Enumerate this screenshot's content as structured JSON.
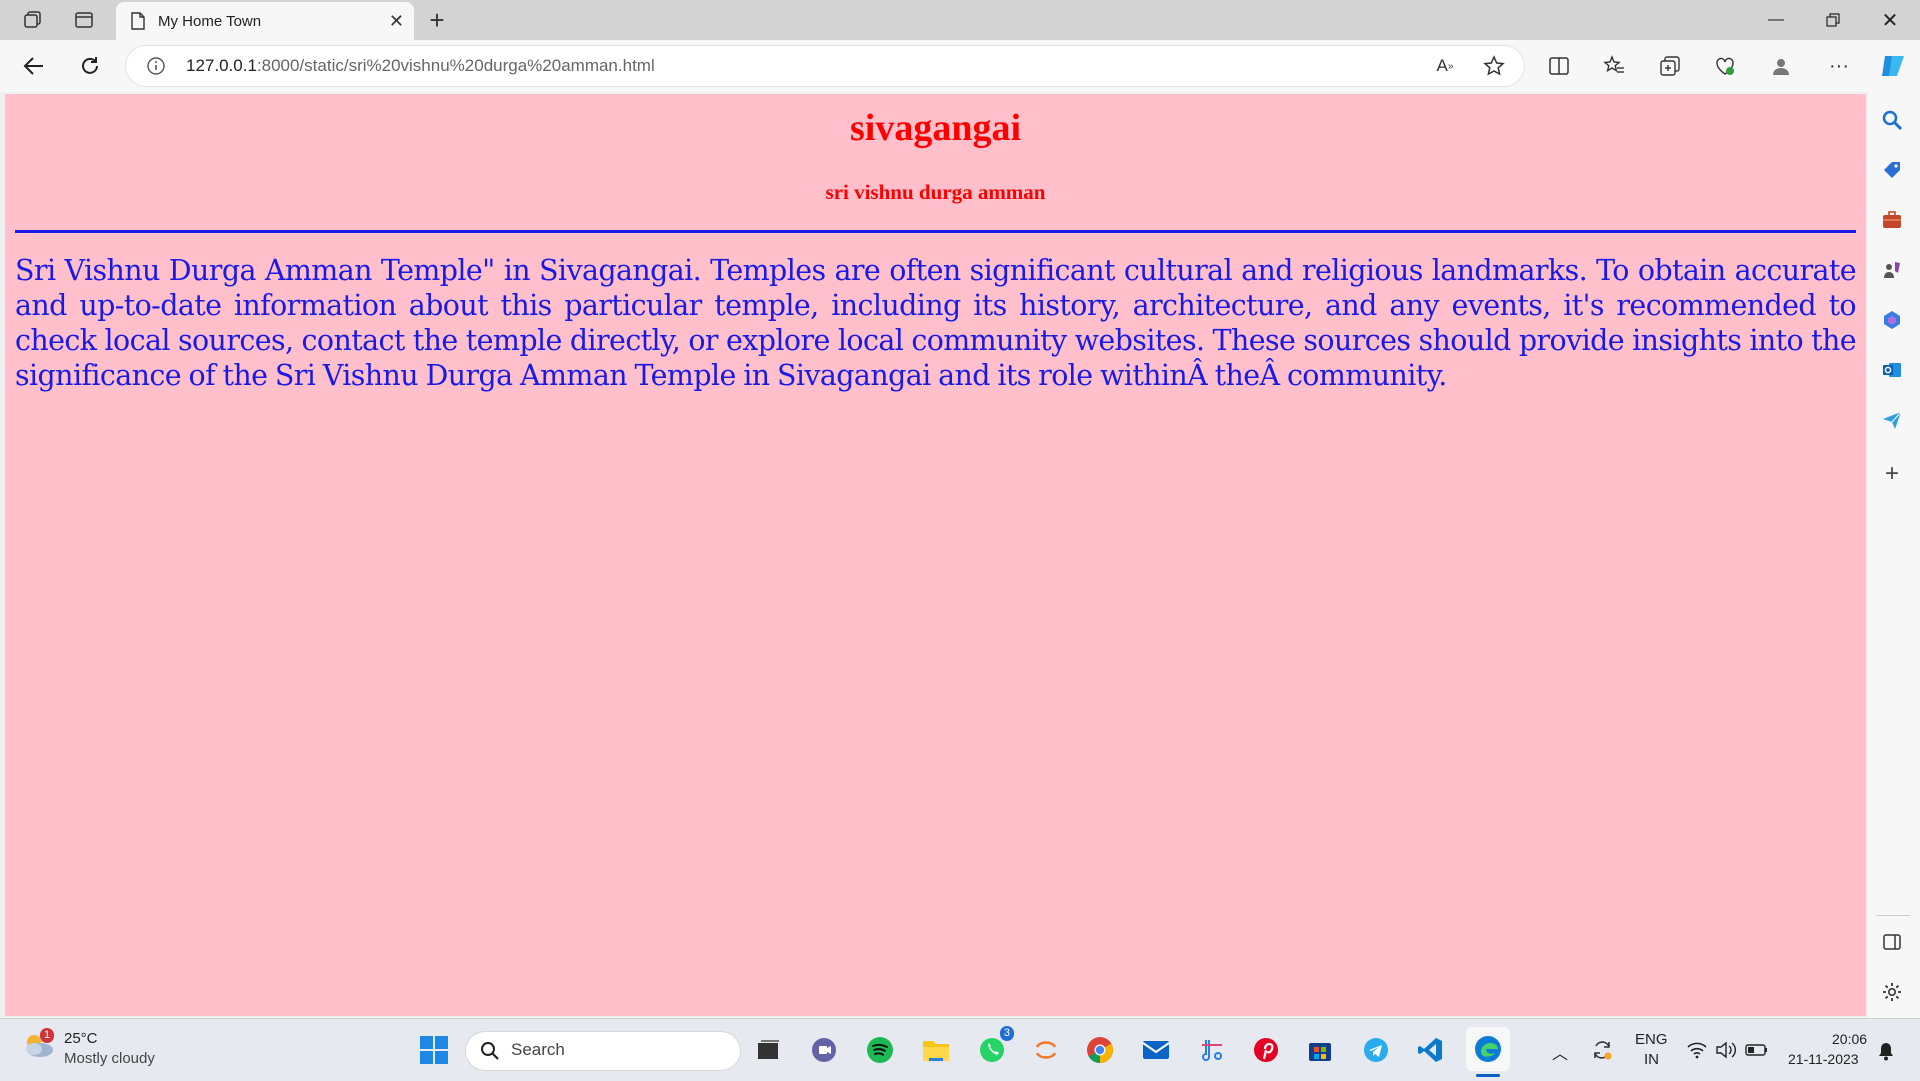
{
  "browser": {
    "tab_title": "My Home Town",
    "new_tab": "+",
    "url_host": "127.0.0.1",
    "url_rest": ":8000/static/sri%20vishnu%20durga%20amman.html"
  },
  "page": {
    "heading": "sivagangai",
    "subheading": "sri vishnu durga amman",
    "paragraph": "Sri Vishnu Durga Amman Temple\" in Sivagangai. Temples are often significant cultural and religious landmarks. To obtain accurate and up-to-date information about this particular temple, including its history, architecture, and any events, it's recommended to check local sources, contact the temple directly, or explore local community websites. These sources should provide insights into the significance of the Sri Vishnu Durga Amman Temple in Sivagangai and its role withinÂ theÂ community."
  },
  "taskbar": {
    "weather_temp": "25°C",
    "weather_desc": "Mostly cloudy",
    "weather_badge": "1",
    "search_label": "Search",
    "whatsapp_badge": "3",
    "lang_top": "ENG",
    "lang_bottom": "IN",
    "time": "20:06",
    "date": "21-11-2023"
  },
  "colors": {
    "page_bg": "#ffc0cb",
    "heading": "#ff0000",
    "text": "#1a1ae6"
  }
}
